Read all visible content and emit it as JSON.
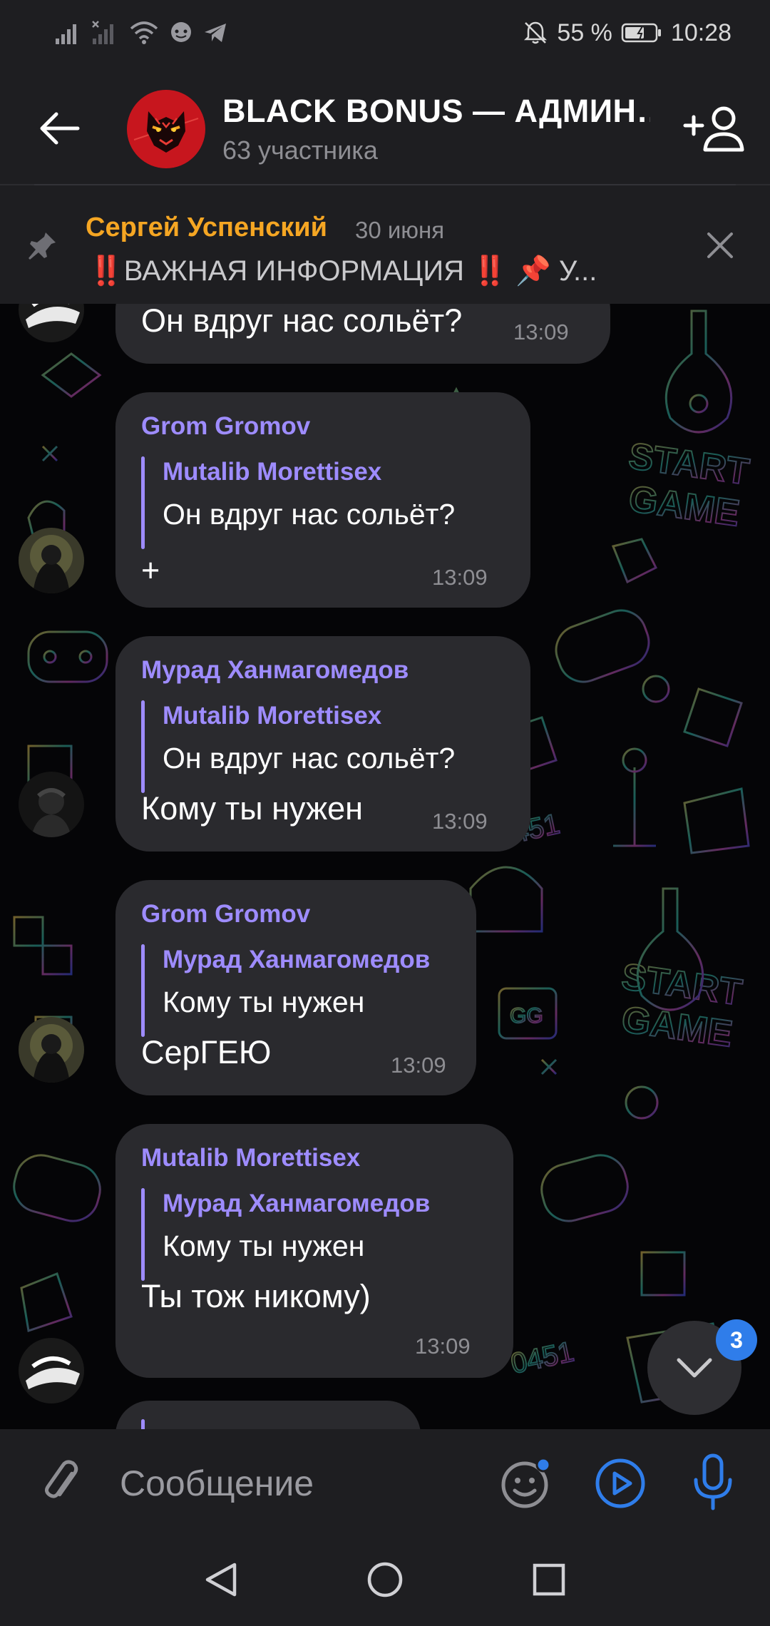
{
  "status_bar": {
    "battery_percent": "55 %",
    "time": "10:28",
    "icons": [
      "signal-icon",
      "signal-no-sim-icon",
      "wifi-icon",
      "chat-notification-icon",
      "telegram-icon",
      "bell-off-icon",
      "battery-icon"
    ]
  },
  "header": {
    "title": "BLACK BONUS — АДМИН…",
    "subtitle": "63 участника"
  },
  "pinned": {
    "author": "Сергей Успенский",
    "date": "30 июня",
    "text": "‼️ВАЖНАЯ ИНФОРМАЦИЯ ‼️   📌 У..."
  },
  "messages": [
    {
      "text": "Он вдруг нас сольёт?",
      "time": "13:09"
    },
    {
      "sender": "Grom Gromov",
      "reply_name": "Mutalib Morettisex",
      "reply_text": "Он вдруг нас сольёт?",
      "text": "+",
      "time": "13:09"
    },
    {
      "sender": "Мурад Ханмагомедов",
      "reply_name": "Mutalib Morettisex",
      "reply_text": "Он вдруг нас сольёт?",
      "text": "Кому ты нужен",
      "time": "13:09"
    },
    {
      "sender": "Grom Gromov",
      "reply_name": "Мурад Ханмагомедов",
      "reply_text": "Кому ты нужен",
      "text": "СерГЕЮ",
      "time": "13:09"
    },
    {
      "sender": "Mutalib Morettisex",
      "reply_name": "Мурад Ханмагомедов",
      "reply_text": "Кому ты нужен",
      "text": "Ты тож никому)",
      "time": "13:09"
    }
  ],
  "scroll_down": {
    "unread_count": "3"
  },
  "composer": {
    "placeholder": "Сообщение"
  },
  "colors": {
    "accent_sender": "#9e8cff",
    "pinned_author": "#f5a623",
    "badge": "#2f7dea",
    "bubble": "#2a2a2e",
    "bar": "#1e1e21"
  }
}
